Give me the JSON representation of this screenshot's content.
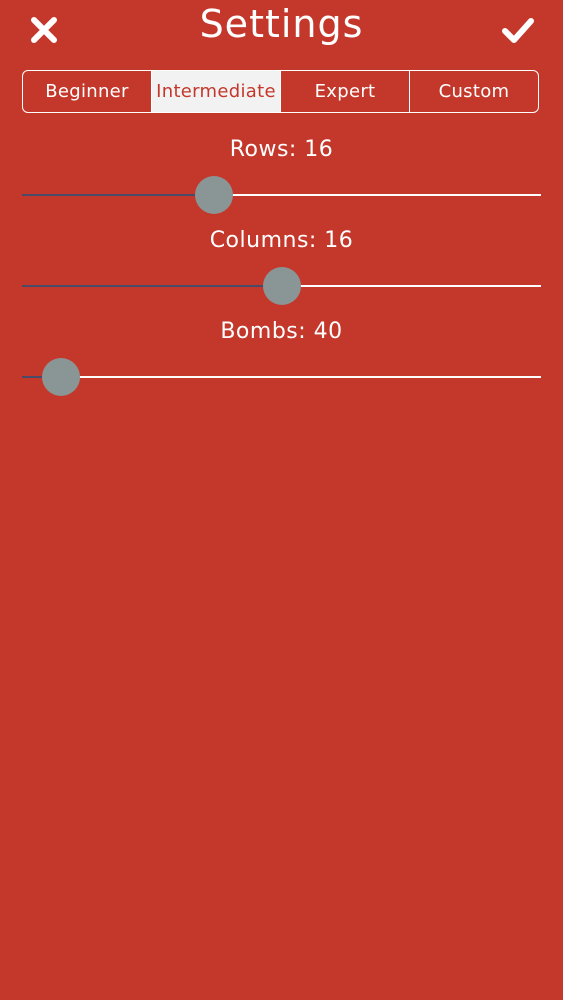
{
  "header": {
    "title": "Settings",
    "close_icon": "close-x-icon",
    "done_icon": "checkmark-icon"
  },
  "difficulty": {
    "options": [
      "Beginner",
      "Intermediate",
      "Expert",
      "Custom"
    ],
    "selected": "Intermediate"
  },
  "sliders": {
    "rows": {
      "label": "Rows: 16",
      "value": 16,
      "fraction": 0.37
    },
    "columns": {
      "label": "Columns: 16",
      "value": 16,
      "fraction": 0.5
    },
    "bombs": {
      "label": "Bombs: 40",
      "value": 40,
      "fraction": 0.075
    }
  },
  "colors": {
    "background": "#c4382b",
    "thumb": "#8a9596",
    "track_filled": "#4a4a6a",
    "track_empty": "#ffffff",
    "selected_segment": "#f2f2f2"
  }
}
